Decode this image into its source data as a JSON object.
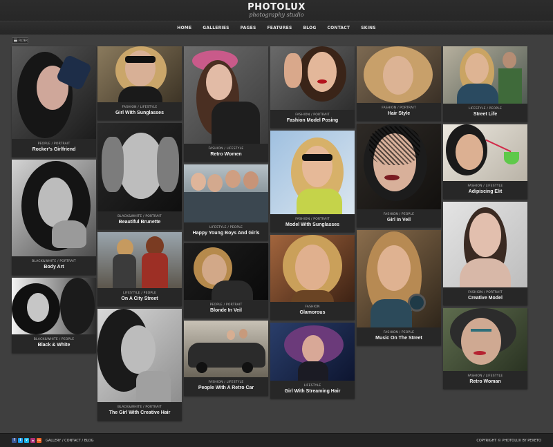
{
  "site": {
    "title": "PHOTOLUX",
    "subtitle": "photography studio"
  },
  "nav": {
    "items": [
      "HOME",
      "GALLERIES",
      "PAGES",
      "FEATURES",
      "BLOG",
      "CONTACT",
      "SKINS"
    ]
  },
  "filter": {
    "label": "FILTER"
  },
  "gallery": [
    {
      "category": "PEOPLE / PORTRAIT",
      "title": "Rocker's Girlfriend"
    },
    {
      "category": "BLACK&WHITE / PORTRAIT",
      "title": "Body Art"
    },
    {
      "category": "BLACK&WHITE / PEOPLE",
      "title": "Black & White"
    },
    {
      "category": "FASHION / LIFESTYLE",
      "title": "Girl With Sunglasses"
    },
    {
      "category": "BLACK&WHITE / PORTRAIT",
      "title": "Beautiful Brunette"
    },
    {
      "category": "LIFESTYLE / PEOPLE",
      "title": "On A City Street"
    },
    {
      "category": "BLACK&WHITE / PORTRAIT",
      "title": "The Girl With Creative Hair"
    },
    {
      "category": "FASHION / LIFESTYLE",
      "title": "Retro Women"
    },
    {
      "category": "LIFESTYLE / PEOPLE",
      "title": "Happy Young Boys And Girls"
    },
    {
      "category": "PEOPLE / PORTRAIT",
      "title": "Blonde In Veil"
    },
    {
      "category": "FASHION / LIFESTYLE",
      "title": "People With A Retro Car"
    },
    {
      "category": "FASHION / PORTRAIT",
      "title": "Fashion Model Posing"
    },
    {
      "category": "FASHION / PORTRAIT",
      "title": "Model With Sunglasses"
    },
    {
      "category": "FASHION",
      "title": "Glamorous"
    },
    {
      "category": "LIFESTYLE",
      "title": "Girl With Streaming Hair"
    },
    {
      "category": "FASHION / PORTRAIT",
      "title": "Hair Style"
    },
    {
      "category": "FASHION / PEOPLE",
      "title": "Girl In Veil"
    },
    {
      "category": "FASHION / PEOPLE",
      "title": "Music On The Street"
    },
    {
      "category": "LIFESTYLE / PEOPLE",
      "title": "Street Life"
    },
    {
      "category": "FASHION / LIFESTYLE",
      "title": "Adipiscing Elit"
    },
    {
      "category": "FASHION / PORTRAIT",
      "title": "Creative Model"
    },
    {
      "category": "FASHION / LIFESTYLE",
      "title": "Retro Woman"
    }
  ],
  "footer": {
    "social": [
      "f",
      "t",
      "v",
      "in",
      "rss"
    ],
    "links": [
      "GALLERY",
      "CONTACT",
      "BLOG"
    ],
    "separator": "/",
    "copyright": "COPYRIGHT © PHOTOLUX BY PEXETO"
  },
  "colors": {
    "background": "#3f3f3f",
    "header": "#262626",
    "caption": "#272727",
    "facebook": "#3b5998",
    "twitter": "#1da1f2",
    "vimeo": "#1ab7ea",
    "instagram": "#b0307a",
    "rss": "#f26522"
  }
}
